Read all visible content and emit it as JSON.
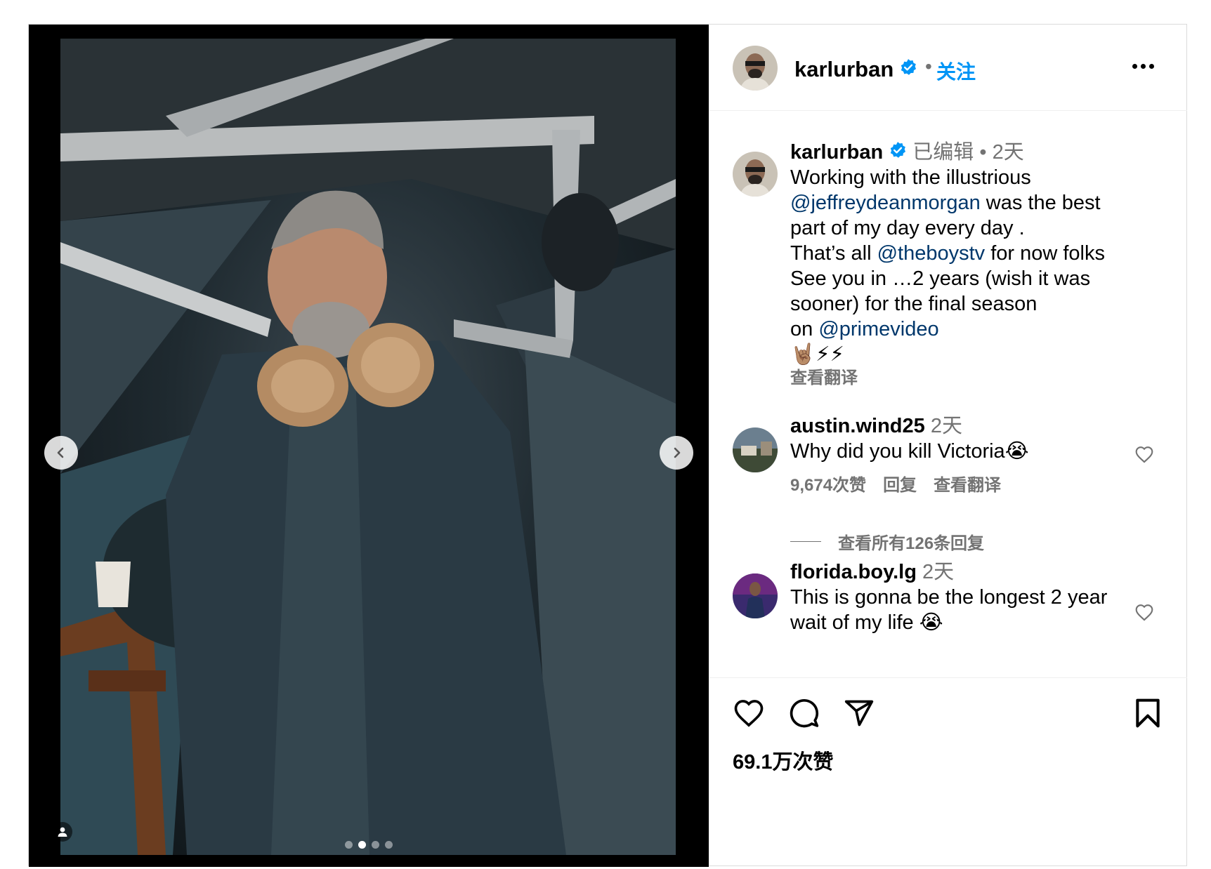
{
  "header": {
    "username": "karlurban",
    "separator": "•",
    "follow_label": "关注"
  },
  "caption": {
    "username": "karlurban",
    "edited": "已编辑",
    "separator": "•",
    "time": "2天",
    "line1": "Working with the illustrious",
    "mention1": "@jeffreydeanmorgan",
    "line2_rest": " was the best",
    "line3": "part of my day every day .",
    "line4_pre": "That’s all ",
    "mention2": "@theboystv",
    "line4_post": " for now folks",
    "line5": "See you in …2 years (wish it was",
    "line6": "sooner) for the final season",
    "line7_pre": "on ",
    "mention3": "@primevideo",
    "emoji": "🤘🏽⚡⚡",
    "see_translation": "查看翻译"
  },
  "comments": [
    {
      "username": "austin.wind25",
      "time": "2天",
      "text_line1": "Why did you kill Victoria😭",
      "likes": "9,674次赞",
      "reply": "回复",
      "see_translation": "查看翻译",
      "view_replies": "查看所有126条回复"
    },
    {
      "username": "florida.boy.lg",
      "time": "2天",
      "text_line1": "This is gonna be the longest 2 year",
      "text_line2": "wait of my life 😭"
    }
  ],
  "footer": {
    "likes": "69.1万次赞"
  },
  "carousel": {
    "slide_count": 4,
    "active_index": 1
  },
  "colors": {
    "accent": "#0095f6",
    "link": "#00376b",
    "muted": "#737373",
    "verified": "#0095f6"
  }
}
